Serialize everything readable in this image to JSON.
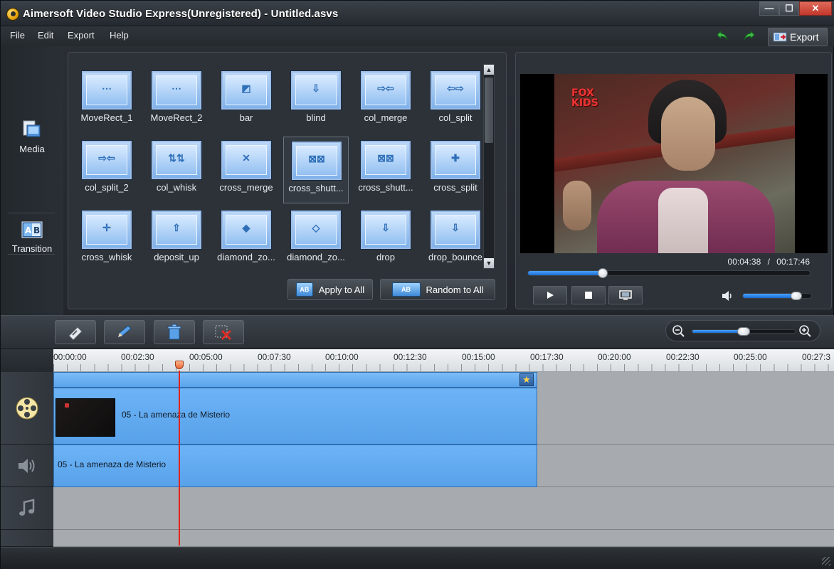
{
  "window": {
    "title": "Aimersoft Video Studio Express(Unregistered) - Untitled.asvs",
    "minimize": "—",
    "maximize": "☐",
    "close": "✕"
  },
  "menu": [
    "File",
    "Edit",
    "Export",
    "Help"
  ],
  "toolbar": {
    "export_label": "Export",
    "undo_icon": "undo-icon",
    "redo_icon": "redo-icon"
  },
  "sidebar": [
    {
      "label": "Media",
      "icon": "media-icon"
    },
    {
      "label": "Transition",
      "icon": "transition-icon"
    }
  ],
  "transitions": [
    {
      "label": "MoveRect_1",
      "glyph": "⋯"
    },
    {
      "label": "MoveRect_2",
      "glyph": "⋯"
    },
    {
      "label": "bar",
      "glyph": "◩"
    },
    {
      "label": "blind",
      "glyph": "⇩"
    },
    {
      "label": "col_merge",
      "glyph": "⇨⇦"
    },
    {
      "label": "col_split",
      "glyph": "⇦⇨"
    },
    {
      "label": "col_split_2",
      "glyph": "⇨⇦"
    },
    {
      "label": "col_whisk",
      "glyph": "⇅⇅"
    },
    {
      "label": "cross_merge",
      "glyph": "✕"
    },
    {
      "label": "cross_shutt...",
      "glyph": "⊠⊠"
    },
    {
      "label": "cross_shutt...",
      "glyph": "⊠⊠"
    },
    {
      "label": "cross_split",
      "glyph": "✚"
    },
    {
      "label": "cross_whisk",
      "glyph": "✛"
    },
    {
      "label": "deposit_up",
      "glyph": "⇧"
    },
    {
      "label": "diamond_zo...",
      "glyph": "◆"
    },
    {
      "label": "diamond_zo...",
      "glyph": "◇"
    },
    {
      "label": "drop",
      "glyph": "⇩"
    },
    {
      "label": "drop_bounce",
      "glyph": "⇩"
    }
  ],
  "panel_buttons": {
    "apply_all": "Apply to All",
    "random_all": "Random to All"
  },
  "preview": {
    "current_time": "00:04:38",
    "separator": "/",
    "total_time": "00:17:46",
    "progress": 0.265,
    "volume": 0.78,
    "logo": "FOX KIDS"
  },
  "timeline": {
    "zoom_level": 0.5,
    "ticks": [
      "00:00:00",
      "00:02:30",
      "00:05:00",
      "00:07:30",
      "00:10:00",
      "00:12:30",
      "00:15:00",
      "00:17:30",
      "00:20:00",
      "00:22:30",
      "00:25:00",
      "00:27:3"
    ],
    "video_clip": "05 - La amenaza de Misterio",
    "audio_clip": "05 - La amenaza de Misterio"
  },
  "colors": {
    "clip": "#6db3f6",
    "playhead": "#e2241c",
    "accent": "#1a6dd0"
  }
}
